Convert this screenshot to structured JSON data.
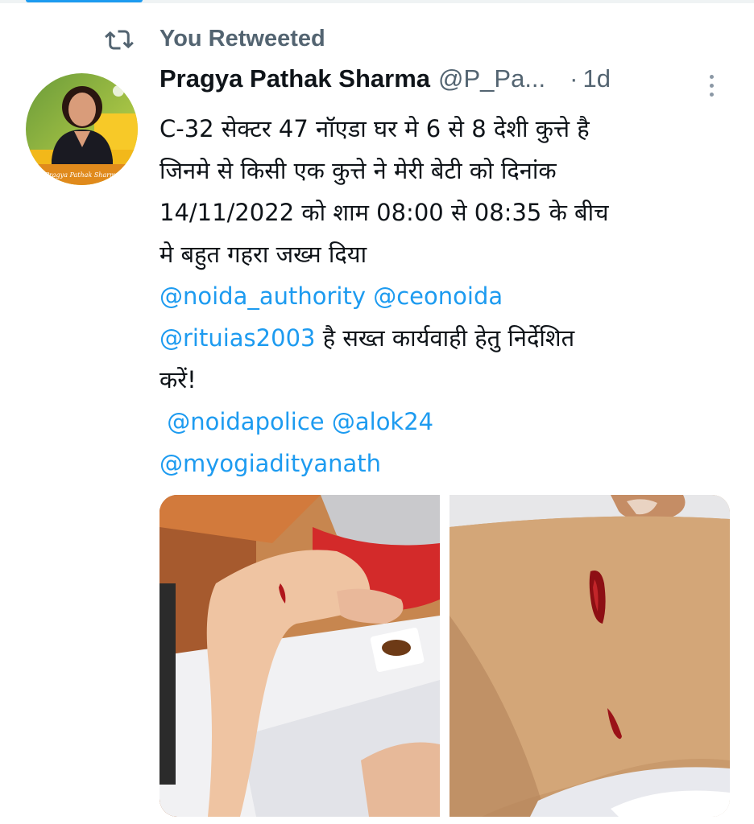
{
  "retweet": {
    "icon": "retweet-icon",
    "label": "You Retweeted"
  },
  "author": {
    "name": "Pragya Pathak Sharma",
    "handle": "@P_Pa...",
    "separator": "·",
    "time": "1d",
    "avatar_caption": "Pragya Pathak Sharma"
  },
  "tweet": {
    "lines": [
      "C-32 सेक्टर 47 नॉएडा घर मे 6 से 8 देशी कुत्ते है",
      "जिनमे से किसी एक कुत्ते ने मेरी बेटी को दिनांक",
      "14/11/2022 को शाम 08:00 से 08:35 के बीच",
      "मे बहुत गहरा जख्म दिया"
    ],
    "mentions_line1": [
      "@noida_authority",
      "@ceonoida"
    ],
    "mention_rituias": "@rituias2003",
    "line_after_rituias": " है सख्त कार्यवाही हेतु निर्देशित",
    "line_kare": "करें!",
    "mentions_line2": [
      "@noidapolice",
      "@alok24"
    ],
    "mention_yogi": "@myogiadityanath"
  },
  "colors": {
    "link": "#1d9bf0",
    "secondary_text": "#536471",
    "primary_text": "#0f1419",
    "accent": "#1d9bf0"
  },
  "media": {
    "count": 2,
    "photos": [
      "wound-photo-leg",
      "wound-photo-closeup"
    ]
  },
  "icons": {
    "more": "more-options-icon"
  }
}
